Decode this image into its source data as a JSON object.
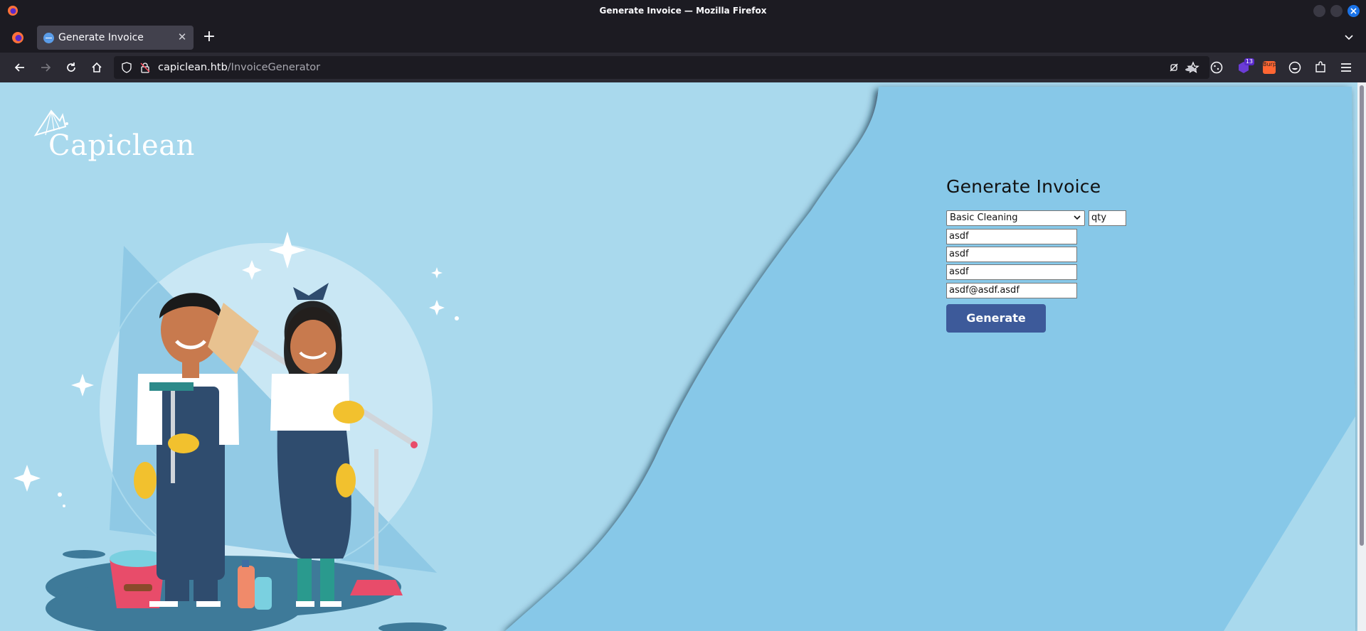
{
  "window": {
    "title": "Generate Invoice — Mozilla Firefox"
  },
  "tabs": [
    {
      "title": "Generate Invoice",
      "active": true
    }
  ],
  "urlbar": {
    "host": "capiclean.htb",
    "path": "/InvoiceGenerator"
  },
  "extensions": {
    "badge_count": "13",
    "burp_label": "Burp"
  },
  "page": {
    "logo_text": "Capiclean",
    "form": {
      "heading": "Generate Invoice",
      "service_selected": "Basic Cleaning",
      "qty_placeholder": "qty",
      "fields": [
        {
          "value": "asdf"
        },
        {
          "value": "asdf"
        },
        {
          "value": "asdf"
        },
        {
          "value": "asdf@asdf.asdf"
        }
      ],
      "submit_label": "Generate"
    }
  },
  "colors": {
    "page_background_light": "#a9d9ed",
    "page_background_wave": "#87c8e8",
    "button": "#3d5a9a",
    "browser_chrome": "#1c1b22"
  }
}
